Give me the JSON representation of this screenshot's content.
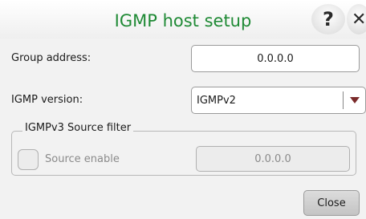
{
  "dialog": {
    "title": "IGMP host setup",
    "help_glyph": "?",
    "close_glyph": "✕"
  },
  "group_address": {
    "label": "Group address:",
    "value": "0.0.0.0"
  },
  "igmp_version": {
    "label": "IGMP version:",
    "value": "IGMPv2"
  },
  "source_filter": {
    "legend": "IGMPv3 Source filter",
    "enable_label": "Source enable",
    "enabled": false,
    "address": "0.0.0.0"
  },
  "footer": {
    "close_label": "Close"
  },
  "colors": {
    "title": "#1f8a35",
    "dropdown_arrow": "#7a2a2a"
  },
  "icons": [
    "help-icon",
    "close-icon",
    "chevron-down-icon"
  ]
}
